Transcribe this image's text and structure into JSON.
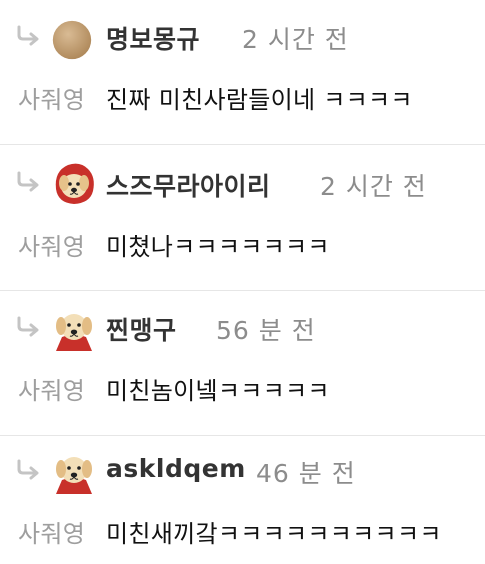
{
  "comments": [
    {
      "username": "명보몽규",
      "time": "2 시간 전",
      "mention": "사줘영",
      "text": "진짜 미친사람들이네 ㅋㅋㅋㅋ",
      "avatar_icon": "brown-circle-avatar"
    },
    {
      "username": "스즈무라아이리",
      "time": "2 시간 전",
      "mention": "사줘영",
      "text": "미쳤나ㅋㅋㅋㅋㅋㅋㅋ",
      "avatar_icon": "puppy-red-hood-avatar"
    },
    {
      "username": "찐맹구",
      "time": "56 분 전",
      "mention": "사줘영",
      "text": "미친놈이넼ㅋㅋㅋㅋㅋ",
      "avatar_icon": "puppy-red-cape-avatar"
    },
    {
      "username": "askldqem",
      "time": "46 분 전",
      "mention": "사줘영",
      "text": "미친새끼갘ㅋㅋㅋㅋㅋㅋㅋㅋㅋㅋ",
      "avatar_icon": "puppy-red-cape-avatar"
    }
  ],
  "colors": {
    "username": "#333333",
    "time": "#8c8c8c",
    "mention": "#9e9e9e",
    "text": "#111111",
    "reply_icon": "#c4c4c4",
    "divider": "#e6e6e6"
  }
}
